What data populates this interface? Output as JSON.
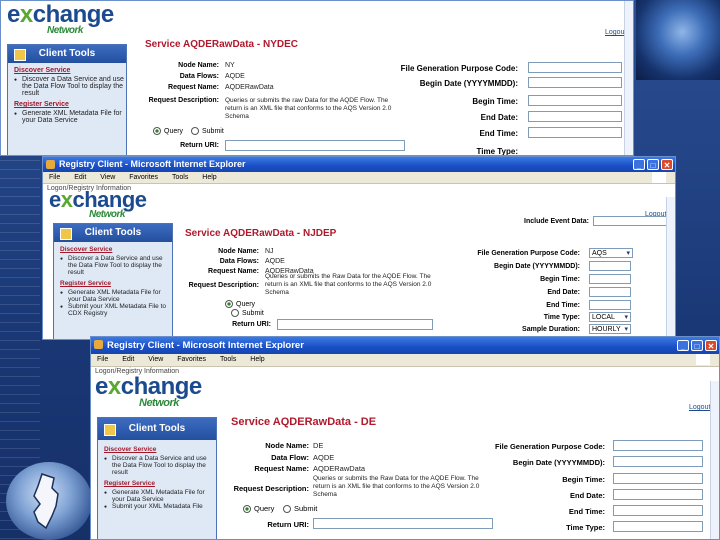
{
  "colors": {
    "accent": "#b0192c",
    "brand": "#1c4a8f",
    "titlebar": "#1a4fc4"
  },
  "win1": {
    "logo": {
      "main": "e",
      "x": "x",
      "rest": "change",
      "net": "Network"
    },
    "logout": "Logout",
    "side_title": "Client Tools",
    "discover": "Discover Service",
    "discover_item": "Discover a Data Service and use the Data Flow Tool to display the result",
    "register": "Register Service",
    "register_item": "Generate XML Metadata File for your Data Service",
    "service_title": "Service AQDERawData - NYDEC",
    "node_label": "Node Name:",
    "node_value": "NY",
    "flow_label": "Data Flows:",
    "flow_value": "AQDE",
    "req_label": "Request Name:",
    "req_value": "AQDERawData",
    "desc_label": "Request Description:",
    "desc_value": "Queries or submits the raw Data for the AQDE Flow. The return is an XML file that conforms to the AQS Version 2.0 Schema",
    "query": "Query",
    "submit": "Submit",
    "ret_label": "Return URI:",
    "r_fgp": "File Generation Purpose Code:",
    "r_bd": "Begin Date (YYYYMMDD):",
    "r_bt": "Begin Time:",
    "r_ed": "End Date:",
    "r_et": "End Time:",
    "r_tt": "Time Type:"
  },
  "win2": {
    "title": "Registry Client - Microsoft Internet Explorer",
    "menu": [
      "File",
      "Edit",
      "View",
      "Favorites",
      "Tools",
      "Help"
    ],
    "sub": "Logon/Registry Information",
    "logo": {
      "main": "e",
      "x": "x",
      "rest": "change",
      "net": "Network"
    },
    "logout": "Logout",
    "side_title": "Client Tools",
    "discover": "Discover Service",
    "discover_item": "Discover a Data Service and use the Data Flow Tool to display the result",
    "register": "Register Service",
    "register_item": "Generate XML Metadata File for your Data Service",
    "register_item2": "Submit your XML Metadata File to CDX Registry",
    "submit_item": "Submit your XML Metadata File to CDX Registry",
    "include": "Include Event Data:",
    "service_title": "Service AQDERawData - NJDEP",
    "node_label": "Node Name:",
    "node_value": "NJ",
    "flow_label": "Data Flows:",
    "flow_value": "AQDE",
    "req_label": "Request Name:",
    "req_value": "AQDERawData",
    "desc_label": "Request Description:",
    "desc_value": "Queries or submits the Raw Data for the AQDE Flow. The return is an XML file that conforms to the AQS Version 2.0 Schema",
    "query": "Query",
    "submit": "Submit",
    "ret_label": "Return URI:",
    "r_fgp": "File Generation Purpose Code:",
    "fgp_val": "AQS",
    "r_bd": "Begin Date (YYYYMMDD):",
    "r_bt": "Begin Time:",
    "r_ed": "End Date:",
    "r_et": "End Time:",
    "r_tt": "Time Type:",
    "tt_val": "LOCAL",
    "r_sd": "Sample Duration:",
    "sd_val": "HOURLY"
  },
  "win3": {
    "title": "Registry Client - Microsoft Internet Explorer",
    "menu": [
      "File",
      "Edit",
      "View",
      "Favorites",
      "Tools",
      "Help"
    ],
    "sub": "Logon/Registry Information",
    "logo": {
      "main": "e",
      "x": "x",
      "rest": "change",
      "net": "Network"
    },
    "logout": "Logout",
    "side_title": "Client Tools",
    "discover": "Discover Service",
    "discover_item": "Discover a Data Service and use the Data Flow Tool to display the result",
    "register": "Register Service",
    "register_item": "Generate XML Metadata File for your Data Service",
    "submit_item": "Submit your XML Metadata File",
    "service_title": "Service AQDERawData - DE",
    "node_label": "Node Name:",
    "node_value": "DE",
    "flow_label": "Data Flow:",
    "flow_value": "AQDE",
    "req_label": "Request Name:",
    "req_value": "AQDERawData",
    "desc_label": "Request Description:",
    "desc_value": "Queries or submits the Raw Data for the AQDE Flow. The return is an XML file that conforms to the AQS Version 2.0 Schema",
    "query": "Query",
    "submit": "Submit",
    "ret_label": "Return URI:",
    "r_fgp": "File Generation Purpose Code:",
    "r_bd": "Begin Date (YYYYMMDD):",
    "r_bt": "Begin Time:",
    "r_ed": "End Date:",
    "r_et": "End Time:",
    "r_tt": "Time Type:"
  }
}
